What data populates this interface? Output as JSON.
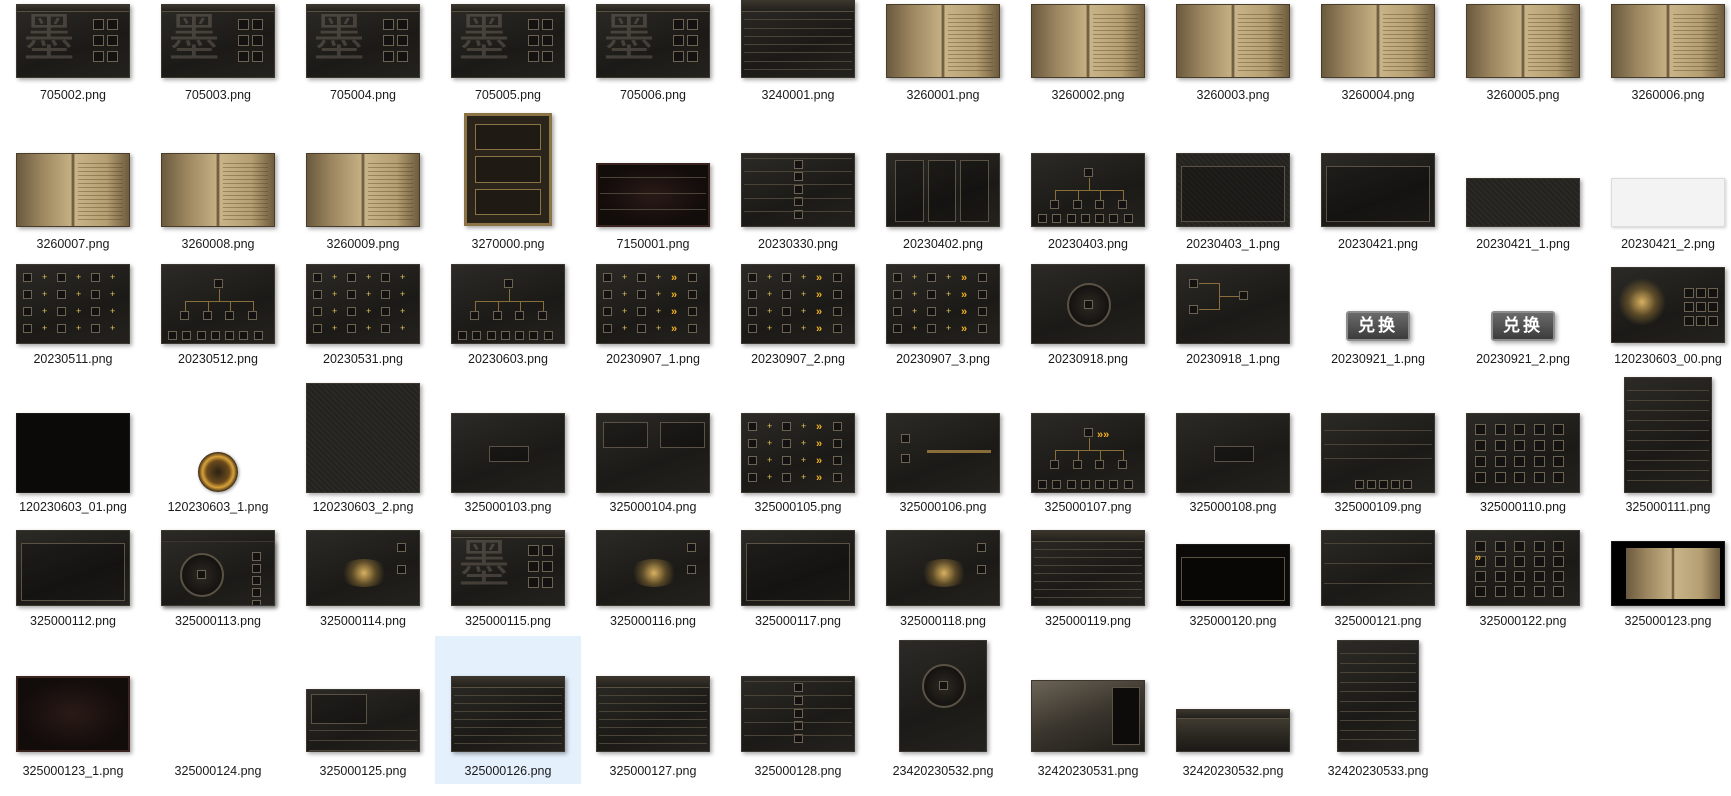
{
  "view": "file-explorer-large-icons",
  "selected_file": "325000126.png",
  "accent_selection": "#e4f1fd",
  "files": [
    {
      "name": "705002.png",
      "style": "dark",
      "deco": "calligraphy"
    },
    {
      "name": "705003.png",
      "style": "dark",
      "deco": "calligraphy"
    },
    {
      "name": "705004.png",
      "style": "dark",
      "deco": "calligraphy"
    },
    {
      "name": "705005.png",
      "style": "dark",
      "deco": "calligraphy"
    },
    {
      "name": "705006.png",
      "style": "dark",
      "deco": "calligraphy"
    },
    {
      "name": "3240001.png",
      "style": "dark",
      "deco": "table"
    },
    {
      "name": "3260001.png",
      "style": "book",
      "deco": "book"
    },
    {
      "name": "3260002.png",
      "style": "book",
      "deco": "book"
    },
    {
      "name": "3260003.png",
      "style": "book",
      "deco": "book"
    },
    {
      "name": "3260004.png",
      "style": "book",
      "deco": "book"
    },
    {
      "name": "3260005.png",
      "style": "book",
      "deco": "book"
    },
    {
      "name": "3260006.png",
      "style": "book",
      "deco": "book"
    },
    {
      "name": "3260007.png",
      "style": "book",
      "deco": "book"
    },
    {
      "name": "3260008.png",
      "style": "book",
      "deco": "book"
    },
    {
      "name": "3260009.png",
      "style": "book",
      "deco": "book"
    },
    {
      "name": "3270000.png",
      "style": "gold",
      "deco": "gold-bars"
    },
    {
      "name": "7150001.png",
      "style": "red",
      "deco": "rows"
    },
    {
      "name": "20230330.png",
      "style": "dark",
      "deco": "rows-slots"
    },
    {
      "name": "20230402.png",
      "style": "dark",
      "deco": "three-cols"
    },
    {
      "name": "20230403.png",
      "style": "dark",
      "deco": "tree"
    },
    {
      "name": "20230403_1.png",
      "style": "tex",
      "deco": "frame"
    },
    {
      "name": "20230421.png",
      "style": "dark",
      "deco": "frame"
    },
    {
      "name": "20230421_1.png",
      "style": "tex",
      "deco": "none"
    },
    {
      "name": "20230421_2.png",
      "style": "light",
      "deco": "none"
    },
    {
      "name": "20230511.png",
      "style": "dark",
      "deco": "plus-grid"
    },
    {
      "name": "20230512.png",
      "style": "dark",
      "deco": "tree"
    },
    {
      "name": "20230531.png",
      "style": "dark",
      "deco": "plus-grid"
    },
    {
      "name": "20230603.png",
      "style": "dark",
      "deco": "tree"
    },
    {
      "name": "20230907_1.png",
      "style": "dark",
      "deco": "plus-chev"
    },
    {
      "name": "20230907_2.png",
      "style": "dark",
      "deco": "plus-chev"
    },
    {
      "name": "20230907_3.png",
      "style": "dark",
      "deco": "plus-chev"
    },
    {
      "name": "20230918.png",
      "style": "dark",
      "deco": "ring"
    },
    {
      "name": "20230918_1.png",
      "style": "dark",
      "deco": "branch"
    },
    {
      "name": "20230921_1.png",
      "style": "btn",
      "deco": "button",
      "label": "兑换"
    },
    {
      "name": "20230921_2.png",
      "style": "btn",
      "deco": "button",
      "label": "兑换"
    },
    {
      "name": "120230603_00.png",
      "style": "dark",
      "deco": "figure"
    },
    {
      "name": "120230603_01.png",
      "style": "black",
      "deco": "none"
    },
    {
      "name": "120230603_1.png",
      "style": "orb",
      "deco": "none"
    },
    {
      "name": "120230603_2.png",
      "style": "tex",
      "deco": "none"
    },
    {
      "name": "325000103.png",
      "style": "dark",
      "deco": "center-panel"
    },
    {
      "name": "325000104.png",
      "style": "dark",
      "deco": "two-panels"
    },
    {
      "name": "325000105.png",
      "style": "dark",
      "deco": "plus-chev"
    },
    {
      "name": "325000106.png",
      "style": "dark",
      "deco": "slots-line"
    },
    {
      "name": "325000107.png",
      "style": "dark",
      "deco": "tree-chev"
    },
    {
      "name": "325000108.png",
      "style": "dark",
      "deco": "center-panel"
    },
    {
      "name": "325000109.png",
      "style": "dark",
      "deco": "form"
    },
    {
      "name": "325000110.png",
      "style": "dark",
      "deco": "slot-grid"
    },
    {
      "name": "325000111.png",
      "style": "dark",
      "deco": "tall-rows"
    },
    {
      "name": "325000112.png",
      "style": "dark",
      "deco": "frame"
    },
    {
      "name": "325000113.png",
      "style": "dark",
      "deco": "slot-grid"
    },
    {
      "name": "325000114.png",
      "style": "dark",
      "deco": "altar"
    },
    {
      "name": "325000115.png",
      "style": "dark",
      "deco": "calligraphy"
    },
    {
      "name": "325000116.png",
      "style": "dark",
      "deco": "altar"
    },
    {
      "name": "325000117.png",
      "style": "dark",
      "deco": "frame"
    },
    {
      "name": "325000118.png",
      "style": "dark",
      "deco": "altar"
    },
    {
      "name": "325000119.png",
      "style": "dark",
      "deco": "table"
    },
    {
      "name": "325000120.png",
      "style": "black",
      "deco": "frame"
    },
    {
      "name": "325000121.png",
      "style": "dark",
      "deco": "rows"
    },
    {
      "name": "325000122.png",
      "style": "dark",
      "deco": "slot-grid-chev"
    },
    {
      "name": "325000123.png",
      "style": "black",
      "deco": "book-small"
    },
    {
      "name": "325000123_1.png",
      "style": "red",
      "deco": "none"
    },
    {
      "name": "325000124.png",
      "style": "dark",
      "deco": "ring-side"
    },
    {
      "name": "325000125.png",
      "style": "dark",
      "deco": "portrait"
    },
    {
      "name": "325000126.png",
      "style": "dark",
      "deco": "table",
      "selected": true
    },
    {
      "name": "325000127.png",
      "style": "dark",
      "deco": "table"
    },
    {
      "name": "325000128.png",
      "style": "dark",
      "deco": "rows-slots"
    },
    {
      "name": "23420230532.png",
      "style": "dark",
      "deco": "tall-ring"
    },
    {
      "name": "32420230531.png",
      "style": "dark",
      "deco": "landscape"
    },
    {
      "name": "32420230532.png",
      "style": "dark",
      "deco": "mountain"
    },
    {
      "name": "32420230533.png",
      "style": "dark",
      "deco": "tall-rows"
    }
  ]
}
